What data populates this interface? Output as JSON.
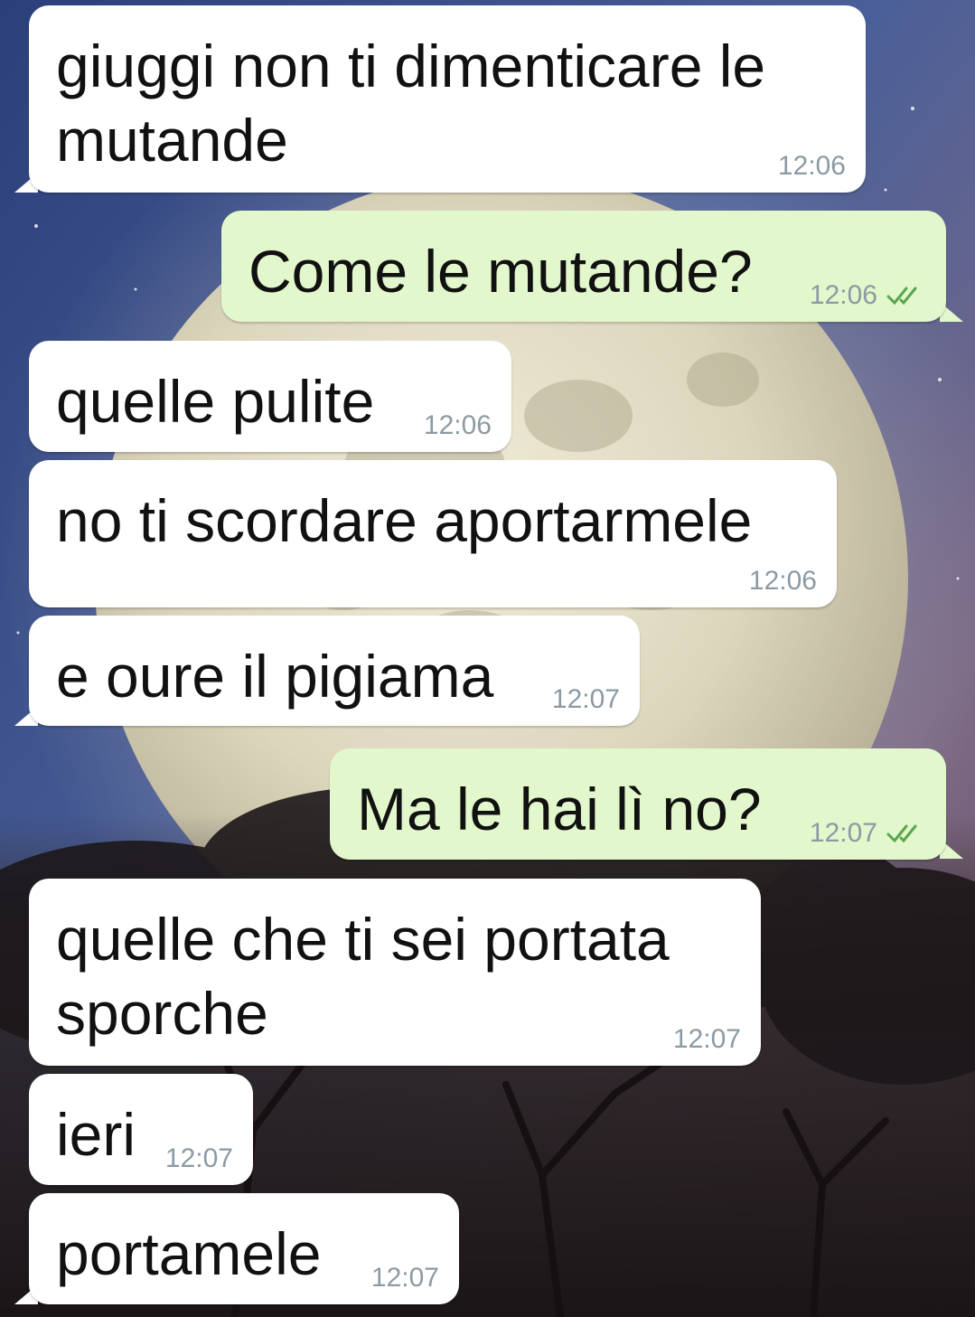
{
  "colors": {
    "incoming_bubble": "#ffffff",
    "outgoing_bubble": "#e2f7cb",
    "timestamp": "#8c9aa3",
    "read_ticks": "#5aa64e"
  },
  "messages": [
    {
      "direction": "in",
      "text": "giuggi non ti dimenticare le\nmutande",
      "time": "12:06"
    },
    {
      "direction": "out",
      "text": "Come le mutande?",
      "time": "12:06",
      "status_icon": "double-check-icon"
    },
    {
      "direction": "in",
      "text": "quelle pulite",
      "time": "12:06"
    },
    {
      "direction": "in",
      "text": "no ti scordare aportarmele",
      "time": "12:06"
    },
    {
      "direction": "in",
      "text": "e oure il pigiama",
      "time": "12:07"
    },
    {
      "direction": "out",
      "text": "Ma le hai lì no?",
      "time": "12:07",
      "status_icon": "double-check-icon"
    },
    {
      "direction": "in",
      "text": "quelle che ti sei portata\nsporche",
      "time": "12:07"
    },
    {
      "direction": "in",
      "text": "ieri",
      "time": "12:07"
    },
    {
      "direction": "in",
      "text": "portamele",
      "time": "12:07"
    }
  ]
}
